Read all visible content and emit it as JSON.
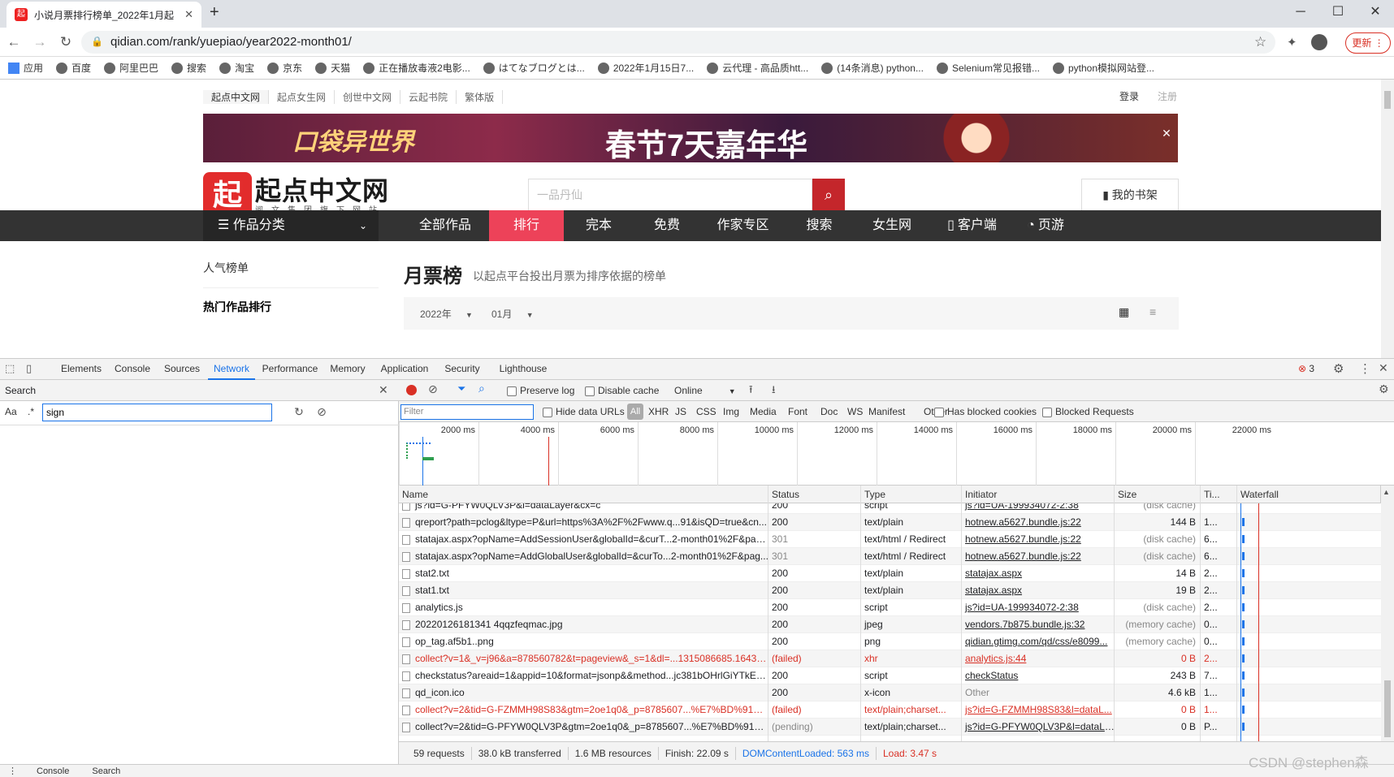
{
  "browser": {
    "tab_title": "小说月票排行榜单_2022年1月起",
    "tab_favicon": "起",
    "new_tab": "+",
    "url": "qidian.com/rank/yuepiao/year2022-month01/",
    "update_label": "更新",
    "bookmarks": [
      "应用",
      "百度",
      "阿里巴巴",
      "搜索",
      "淘宝",
      "京东",
      "天猫",
      "正在播放毒液2电影...",
      "はてなブログとは...",
      "2022年1月15日7...",
      "云代理 - 高品质htt...",
      "(14条消息) python...",
      "Selenium常见报错...",
      "python模拟网站登..."
    ]
  },
  "page": {
    "topnav": [
      "起点中文网",
      "起点女生网",
      "创世中文网",
      "云起书院",
      "繁体版"
    ],
    "login": "登录",
    "register": "注册",
    "banner_text1": "口袋异世界",
    "banner_text2": "春节7天嘉年华",
    "logo_char": "起",
    "logo_text": "起点中文网",
    "logo_sub": "阅文集团旗下网站",
    "search_placeholder": "一品丹仙",
    "shelf_label": "我的书架",
    "category_label": "作品分类",
    "mainnav": [
      "全部作品",
      "排行",
      "完本",
      "免费",
      "作家专区",
      "搜索",
      "女生网",
      "客户端",
      "页游"
    ],
    "side_popular": "人气榜单",
    "side_hot": "热门作品排行",
    "rank_title": "月票榜",
    "rank_desc": "以起点平台投出月票为排序依据的榜单",
    "year_sel": "2022年",
    "month_sel": "01月"
  },
  "devtools": {
    "tabs": [
      "Elements",
      "Console",
      "Sources",
      "Network",
      "Performance",
      "Memory",
      "Application",
      "Security",
      "Lighthouse"
    ],
    "active_tab": "Network",
    "error_count": "3",
    "search": {
      "title": "Search",
      "aa": "Aa",
      "regex": ".*",
      "query": "sign"
    },
    "network": {
      "preserve_log": "Preserve log",
      "disable_cache": "Disable cache",
      "throttle": "Online",
      "filter_placeholder": "Filter",
      "hide_data_urls": "Hide data URLs",
      "types": [
        "All",
        "XHR",
        "JS",
        "CSS",
        "Img",
        "Media",
        "Font",
        "Doc",
        "WS",
        "Manifest",
        "Other"
      ],
      "has_blocked_cookies": "Has blocked cookies",
      "blocked_requests": "Blocked Requests",
      "timeline_ticks": [
        "2000 ms",
        "4000 ms",
        "6000 ms",
        "8000 ms",
        "10000 ms",
        "12000 ms",
        "14000 ms",
        "16000 ms",
        "18000 ms",
        "20000 ms",
        "22000 ms"
      ],
      "columns": [
        "Name",
        "Status",
        "Type",
        "Initiator",
        "Size",
        "Ti...",
        "Waterfall"
      ],
      "rows": [
        {
          "name": "js?id=G-PFYW0QLV3P&l=dataLayer&cx=c",
          "status": "200",
          "type": "script",
          "initiator": "js?id=UA-199934072-2:38",
          "size": "(disk cache)",
          "time": "",
          "failed": false
        },
        {
          "name": "qreport?path=pclog&ltype=P&url=https%3A%2F%2Fwww.q...91&isQD=true&cn...",
          "status": "200",
          "type": "text/plain",
          "initiator": "hotnew.a5627.bundle.js:22",
          "size": "144 B",
          "time": "1...",
          "failed": false
        },
        {
          "name": "statajax.aspx?opName=AddSessionUser&globalId=&curT...2-month01%2F&page...",
          "status": "301",
          "type": "text/html / Redirect",
          "initiator": "hotnew.a5627.bundle.js:22",
          "size": "(disk cache)",
          "time": "6...",
          "failed": false
        },
        {
          "name": "statajax.aspx?opName=AddGlobalUser&globalId=&curTo...2-month01%2F&pag...",
          "status": "301",
          "type": "text/html / Redirect",
          "initiator": "hotnew.a5627.bundle.js:22",
          "size": "(disk cache)",
          "time": "6...",
          "failed": false
        },
        {
          "name": "stat2.txt",
          "status": "200",
          "type": "text/plain",
          "initiator": "statajax.aspx",
          "size": "14 B",
          "time": "2...",
          "failed": false
        },
        {
          "name": "stat1.txt",
          "status": "200",
          "type": "text/plain",
          "initiator": "statajax.aspx",
          "size": "19 B",
          "time": "2...",
          "failed": false
        },
        {
          "name": "analytics.js",
          "status": "200",
          "type": "script",
          "initiator": "js?id=UA-199934072-2:38",
          "size": "(disk cache)",
          "time": "2...",
          "failed": false
        },
        {
          "name": "20220126181341 4qqzfeqmac.jpg",
          "status": "200",
          "type": "jpeg",
          "initiator": "vendors.7b875.bundle.js:32",
          "size": "(memory cache)",
          "time": "0...",
          "failed": false
        },
        {
          "name": "op_tag.af5b1..png",
          "status": "200",
          "type": "png",
          "initiator": "qidian.gtimg.com/qd/css/e8099...",
          "size": "(memory cache)",
          "time": "0...",
          "failed": false
        },
        {
          "name": "collect?v=1&_v=j96&a=878560782&t=pageview&_s=1&dl=...1315086685.16436...",
          "status": "(failed)",
          "type": "xhr",
          "initiator": "analytics.js:44",
          "size": "0 B",
          "time": "2...",
          "failed": true
        },
        {
          "name": "checkstatus?areaid=1&appid=10&format=jsonp&&method...jc381bOHrlGiYTkE1...",
          "status": "200",
          "type": "script",
          "initiator": "checkStatus",
          "size": "243 B",
          "time": "7...",
          "failed": false
        },
        {
          "name": "qd_icon.ico",
          "status": "200",
          "type": "x-icon",
          "initiator": "Other",
          "size": "4.6 kB",
          "time": "1...",
          "failed": false
        },
        {
          "name": "collect?v=2&tid=G-FZMMH98S83&gtm=2oe1q0&_p=8785607...%E7%BD%91&si...",
          "status": "(failed)",
          "type": "text/plain;charset...",
          "initiator": "js?id=G-FZMMH98S83&l=dataL...",
          "size": "0 B",
          "time": "1...",
          "failed": true
        },
        {
          "name": "collect?v=2&tid=G-PFYW0QLV3P&gtm=2oe1q0&_p=8785607...%E7%BD%91&si...",
          "status": "(pending)",
          "type": "text/plain;charset...",
          "initiator": "js?id=G-PFYW0QLV3P&l=dataLa...",
          "size": "0 B",
          "time": "P...",
          "failed": false
        }
      ],
      "status_bar": {
        "requests": "59 requests",
        "transferred": "38.0 kB transferred",
        "resources": "1.6 MB resources",
        "finish": "Finish: 22.09 s",
        "dcl": "DOMContentLoaded: 563 ms",
        "load": "Load: 3.47 s"
      }
    },
    "drawer": [
      "Console",
      "Search"
    ]
  },
  "watermark": "CSDN @stephen森",
  "colors": {
    "accent": "#1a73e8",
    "brand": "#ed4259",
    "error": "#d93025"
  }
}
